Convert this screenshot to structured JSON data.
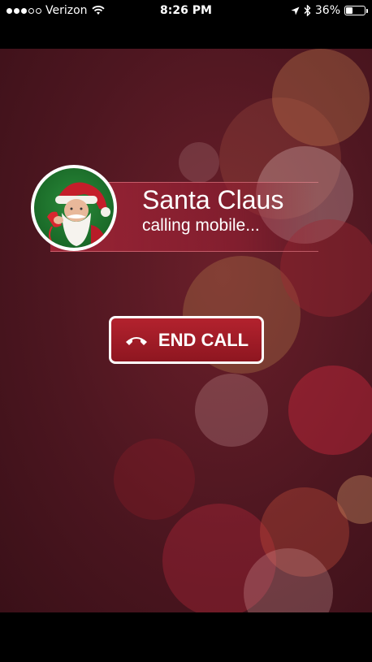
{
  "status_bar": {
    "carrier": "Verizon",
    "time": "8:26 PM",
    "battery": "36%",
    "battery_level": 0.36,
    "signal_bars_filled": 3,
    "signal_bars_total": 5
  },
  "caller": {
    "name": "Santa Claus",
    "status": "calling mobile..."
  },
  "actions": {
    "end_call_label": "END CALL"
  },
  "icons": {
    "wifi": "wifi-icon",
    "location": "location-arrow-icon",
    "bluetooth": "bluetooth-icon",
    "battery": "battery-icon",
    "end_call": "phone-hangup-icon"
  },
  "colors": {
    "background": "#4d1620",
    "button": "#b3222e",
    "accent_band": "#b4283c"
  }
}
